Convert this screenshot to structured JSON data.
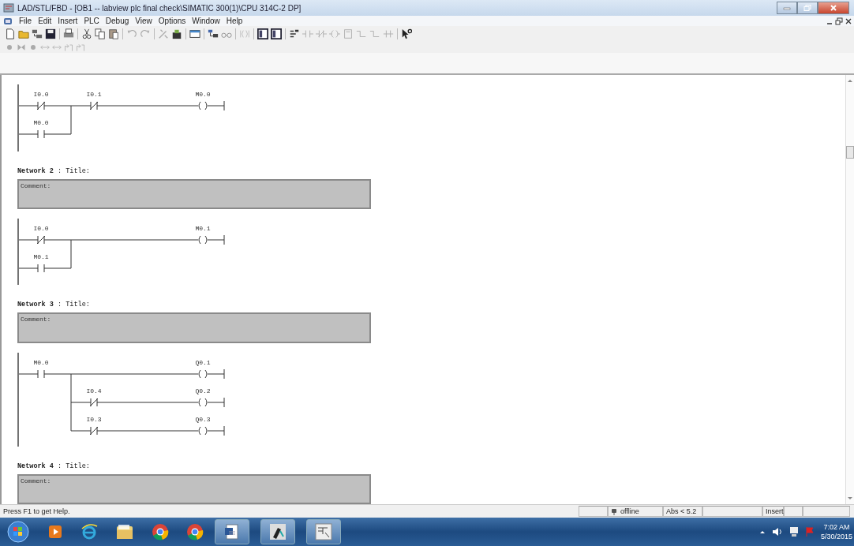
{
  "window": {
    "title": "LAD/STL/FBD  - [OB1 -- labview plc final check\\SIMATIC 300(1)\\CPU 314C-2 DP]"
  },
  "menu": [
    "File",
    "Edit",
    "Insert",
    "PLC",
    "Debug",
    "View",
    "Options",
    "Window",
    "Help"
  ],
  "networks": [
    {
      "kind": "seal_in",
      "rows": [
        {
          "contacts": [
            {
              "kind": "nc",
              "label": "I0.0"
            },
            {
              "kind": "nc",
              "label": "I0.1"
            }
          ],
          "coil": "M0.0"
        },
        {
          "contacts": [
            {
              "kind": "no",
              "label": "M0.0"
            }
          ]
        }
      ]
    },
    {
      "header": "**Network 2** : Title:",
      "comment": "Comment:",
      "kind": "seal_in",
      "rows": [
        {
          "contacts": [
            {
              "kind": "nc",
              "label": "I0.0"
            }
          ],
          "coil": "M0.1"
        },
        {
          "contacts": [
            {
              "kind": "no",
              "label": "M0.1"
            }
          ]
        }
      ]
    },
    {
      "header": "**Network 3** : Title:",
      "comment": "Comment:",
      "kind": "branch_out",
      "rows": [
        {
          "contacts": [
            {
              "kind": "no",
              "label": "M0.0"
            }
          ],
          "coil": "Q0.1"
        },
        {
          "contacts": [
            {
              "kind": "nc",
              "label": "I0.4"
            }
          ],
          "coil": "Q0.2"
        },
        {
          "contacts": [
            {
              "kind": "nc",
              "label": "I0.3"
            }
          ],
          "coil": "Q0.3"
        }
      ]
    },
    {
      "header": "**Network 4** : Title:",
      "comment": "Comment:"
    }
  ],
  "status_bar": {
    "help": "Press F1 to get Help.",
    "connection": "offline",
    "address": "Abs < 5.2",
    "mode": "Insert"
  },
  "taskbar": {
    "time": "7:02 AM",
    "date": "5/30/2015"
  }
}
